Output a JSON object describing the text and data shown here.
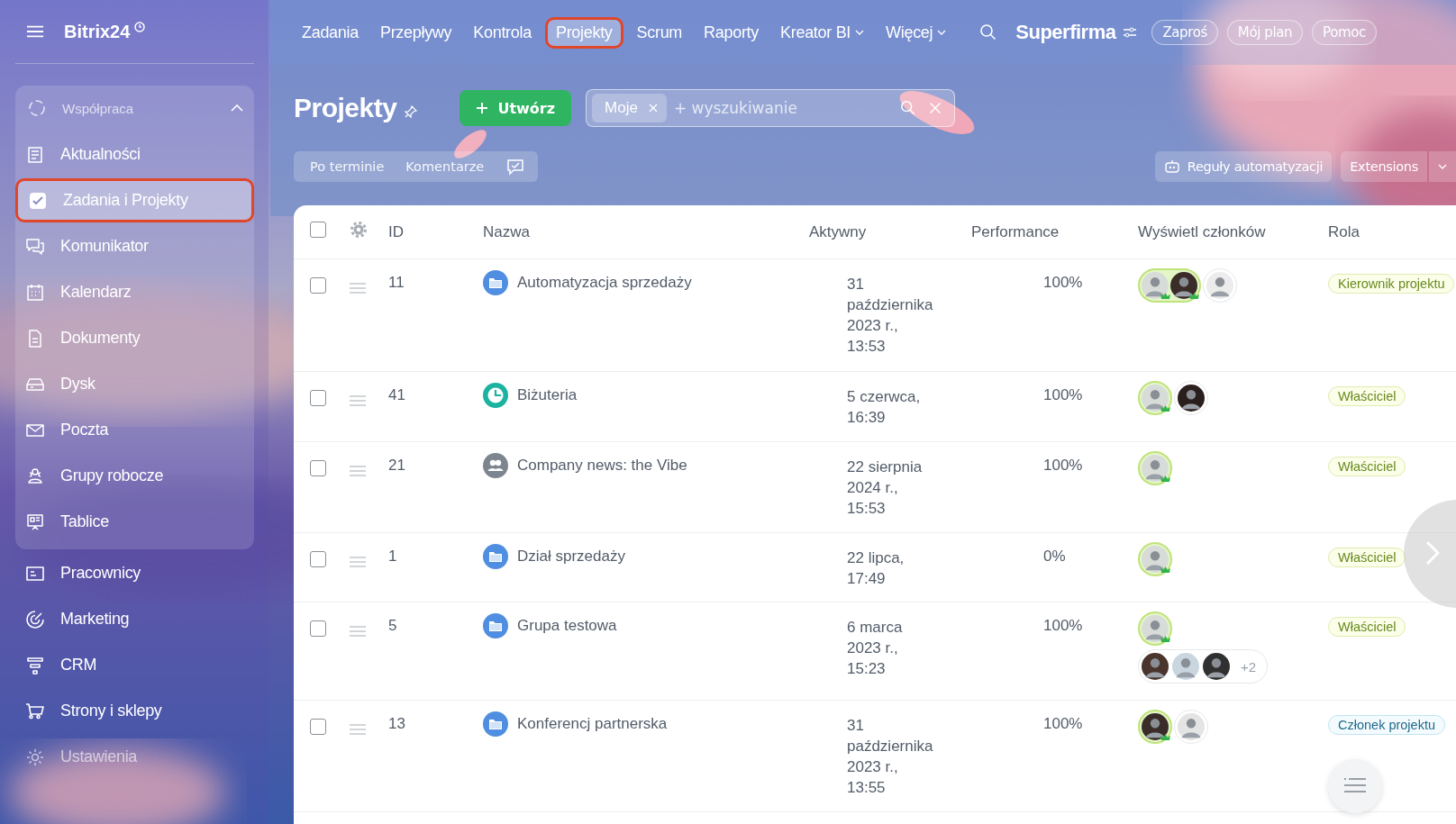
{
  "brand": {
    "name": "Bitrix24"
  },
  "sidebar": {
    "group": {
      "label": "Współpraca",
      "expanded": true,
      "items": [
        {
          "label": "Aktualności",
          "selected": false
        },
        {
          "label": "Zadania i Projekty",
          "selected": true
        },
        {
          "label": "Komunikator",
          "selected": false
        },
        {
          "label": "Kalendarz",
          "selected": false
        },
        {
          "label": "Dokumenty",
          "selected": false
        },
        {
          "label": "Dysk",
          "selected": false
        },
        {
          "label": "Poczta",
          "selected": false
        },
        {
          "label": "Grupy robocze",
          "selected": false
        },
        {
          "label": "Tablice",
          "selected": false
        }
      ]
    },
    "items": [
      {
        "label": "Pracownicy",
        "selected": false,
        "disabled": false
      },
      {
        "label": "Marketing",
        "selected": false,
        "disabled": false
      },
      {
        "label": "CRM",
        "selected": false,
        "disabled": false
      },
      {
        "label": "Strony i sklepy",
        "selected": false,
        "disabled": false
      },
      {
        "label": "Ustawienia",
        "selected": false,
        "disabled": true
      }
    ]
  },
  "top_nav": {
    "items": [
      {
        "label": "Zadania",
        "selected": false,
        "dropdown": false
      },
      {
        "label": "Przepływy",
        "selected": false,
        "dropdown": false
      },
      {
        "label": "Kontrola",
        "selected": false,
        "dropdown": false
      },
      {
        "label": "Projekty",
        "selected": true,
        "dropdown": false
      },
      {
        "label": "Scrum",
        "selected": false,
        "dropdown": false
      },
      {
        "label": "Raporty",
        "selected": false,
        "dropdown": false
      },
      {
        "label": "Kreator BI",
        "selected": false,
        "dropdown": true
      },
      {
        "label": "Więcej",
        "selected": false,
        "dropdown": true
      }
    ],
    "company": "Superfirma",
    "buttons": [
      "Zaproś",
      "Mój plan",
      "Pomoc"
    ]
  },
  "page": {
    "title": "Projekty",
    "create_button": "Utwórz",
    "search": {
      "chip": "Moje",
      "placeholder": "+ wyszukiwanie"
    },
    "filters": [
      "Po terminie",
      "Komentarze"
    ],
    "automation_button": "Reguły automatyzacji",
    "extensions_button": "Extensions"
  },
  "table": {
    "columns": [
      "ID",
      "Nazwa",
      "Aktywny",
      "Performance",
      "Wyświetl członków",
      "Rola"
    ],
    "all_checked": false,
    "rows": [
      {
        "checked": false,
        "id": "11",
        "kind": "folder",
        "name": "Automatyzacja sprzedaży",
        "active": [
          "31",
          "października",
          "2023 r.,",
          "13:53"
        ],
        "performance": "100%",
        "owners": [
          {
            "color": "#d8dcd8"
          },
          {
            "color": "#3a2c28"
          }
        ],
        "members": [
          {
            "color": "#ececec"
          }
        ],
        "role": {
          "text": "Kierownik projektu",
          "kind": "lead"
        }
      },
      {
        "checked": false,
        "id": "41",
        "kind": "scrum",
        "name": "Biżuteria",
        "active": [
          "5 czerwca,",
          "16:39"
        ],
        "performance": "100%",
        "owners": [
          {
            "color": "#d8dcd8"
          }
        ],
        "members": [
          {
            "color": "#2a1f1c"
          }
        ],
        "role": {
          "text": "Właściciel",
          "kind": "owner"
        }
      },
      {
        "checked": false,
        "id": "21",
        "kind": "group",
        "name": "Company news: the Vibe",
        "active": [
          "22 sierpnia",
          "2024 r.,",
          "15:53"
        ],
        "performance": "100%",
        "owners": [
          {
            "color": "#d8dcd8"
          }
        ],
        "members": [],
        "role": {
          "text": "Właściciel",
          "kind": "owner"
        }
      },
      {
        "checked": false,
        "id": "1",
        "kind": "folder",
        "name": "Dział sprzedaży",
        "active": [
          "22 lipca,",
          "17:49"
        ],
        "performance": "0%",
        "owners": [
          {
            "color": "#d8dcd8"
          }
        ],
        "members": [],
        "role": {
          "text": "Właściciel",
          "kind": "owner"
        }
      },
      {
        "checked": false,
        "id": "5",
        "kind": "folder",
        "name": "Grupa testowa",
        "active": [
          "6 marca",
          "2023 r.,",
          "15:23"
        ],
        "performance": "100%",
        "owners": [
          {
            "color": "#d8dcd8"
          }
        ],
        "members": [
          {
            "color": "#4a342c"
          },
          {
            "color": "#c9d6e0"
          },
          {
            "color": "#303030"
          }
        ],
        "more": "+2",
        "role": {
          "text": "Właściciel",
          "kind": "owner"
        }
      },
      {
        "checked": false,
        "id": "13",
        "kind": "folder",
        "name": "Konferencj partnerska",
        "active": [
          "31",
          "października",
          "2023 r.,",
          "13:55"
        ],
        "performance": "100%",
        "owners": [
          {
            "color": "#3a2c28"
          }
        ],
        "members": [
          {
            "color": "#e4e4e4"
          }
        ],
        "role": {
          "text": "Członek projektu",
          "kind": "member"
        }
      }
    ]
  }
}
